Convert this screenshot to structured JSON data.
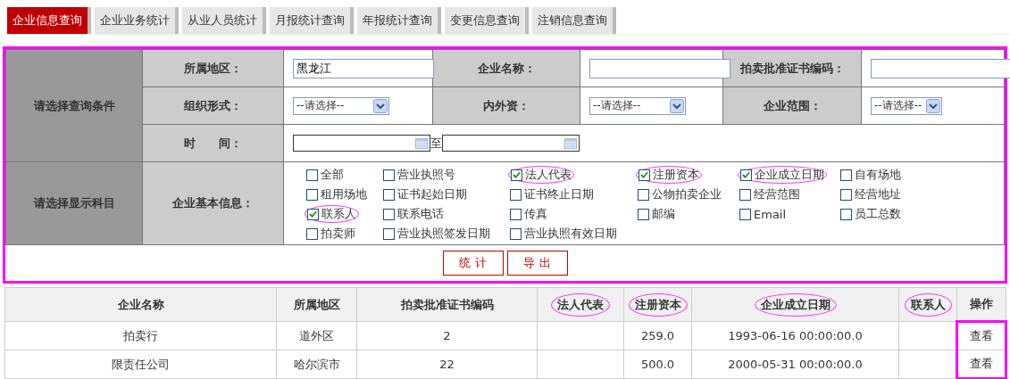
{
  "tabs": [
    {
      "label": "企业信息查询",
      "selected": true
    },
    {
      "label": "企业业务统计",
      "selected": false
    },
    {
      "label": "从业人员统计",
      "selected": false
    },
    {
      "label": "月报统计查询",
      "selected": false
    },
    {
      "label": "年报统计查询",
      "selected": false
    },
    {
      "label": "变更信息查询",
      "selected": false
    },
    {
      "label": "注销信息查询",
      "selected": false
    }
  ],
  "query_form": {
    "highlighted": true,
    "section_label": "请选择查询条件",
    "rows": [
      [
        {
          "label": "所属地区：",
          "kind": "text",
          "value": "黑龙江"
        },
        {
          "label": "企业名称：",
          "kind": "text"
        },
        {
          "label": "拍卖批准证书编码：",
          "kind": "text"
        }
      ],
      [
        {
          "label": "组织形式：",
          "kind": "select",
          "value": "--请选择--"
        },
        {
          "label": "内外资：",
          "kind": "select",
          "value": "--请选择--"
        },
        {
          "label": "企业范围：",
          "kind": "select",
          "value": "--请选择--"
        }
      ]
    ],
    "time": {
      "label": "时　　间：",
      "separator": "至"
    },
    "display_section_label": "请选择显示科目",
    "display_group_label": "企业基本信息：",
    "options": [
      {
        "label": "全部",
        "checked": false,
        "circled": false
      },
      {
        "label": "营业执照号",
        "checked": false,
        "circled": false
      },
      {
        "label": "法人代表",
        "checked": true,
        "circled": true
      },
      {
        "label": "注册资本",
        "checked": true,
        "circled": true
      },
      {
        "label": "企业成立日期",
        "checked": true,
        "circled": true
      },
      {
        "label": "自有场地",
        "checked": false,
        "circled": false
      },
      {
        "label": "租用场地",
        "checked": false,
        "circled": false
      },
      {
        "label": "证书起始日期",
        "checked": false,
        "circled": false
      },
      {
        "label": "证书终止日期",
        "checked": false,
        "circled": false
      },
      {
        "label": "公物拍卖企业",
        "checked": false,
        "circled": false
      },
      {
        "label": "经营范围",
        "checked": false,
        "circled": false
      },
      {
        "label": "经营地址",
        "checked": false,
        "circled": false
      },
      {
        "label": "联系人",
        "checked": true,
        "circled": true
      },
      {
        "label": "联系电话",
        "checked": false,
        "circled": false
      },
      {
        "label": "传真",
        "checked": false,
        "circled": false
      },
      {
        "label": "邮编",
        "checked": false,
        "circled": false
      },
      {
        "label": "Email",
        "checked": false,
        "circled": false
      },
      {
        "label": "员工总数",
        "checked": false,
        "circled": false
      },
      {
        "label": "拍卖师",
        "checked": false,
        "circled": false
      },
      {
        "label": "营业执照签发日期",
        "checked": false,
        "circled": false
      },
      {
        "label": "营业执照有效日期",
        "checked": false,
        "circled": false
      }
    ],
    "buttons": [
      "统 计",
      "导 出"
    ]
  },
  "results": {
    "columns": [
      {
        "label": "企业名称",
        "circled": false
      },
      {
        "label": "所属地区",
        "circled": false
      },
      {
        "label": "拍卖批准证书编码",
        "circled": false
      },
      {
        "label": "法人代表",
        "circled": true
      },
      {
        "label": "注册资本",
        "circled": true
      },
      {
        "label": "企业成立日期",
        "circled": true
      },
      {
        "label": "联系人",
        "circled": true
      },
      {
        "label": "操作",
        "circled": false
      }
    ],
    "action_column_highlighted": true,
    "rows": [
      {
        "cells": [
          "拍卖行",
          "道外区",
          "2",
          "",
          "259.0",
          "1993-06-16 00:00:00.0",
          ""
        ],
        "action": "查看"
      },
      {
        "cells": [
          "限责任公司",
          "哈尔滨市",
          "22",
          "",
          "500.0",
          "2000-05-31 00:00:00.0",
          ""
        ],
        "action": "查看"
      }
    ]
  }
}
